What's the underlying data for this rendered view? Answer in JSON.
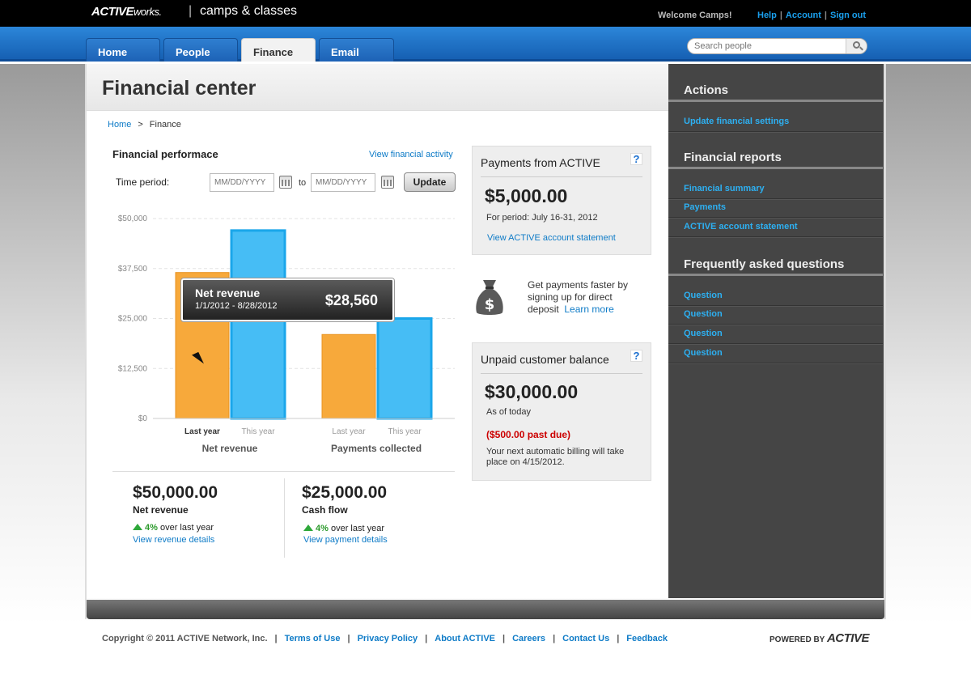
{
  "header": {
    "logo_brand": "ACTIVE",
    "logo_suffix": "works.",
    "separator": "|",
    "product": "camps & classes",
    "welcome": "Welcome Camps!",
    "links": [
      "Help",
      "Account",
      "Sign out"
    ]
  },
  "nav": {
    "tabs": [
      "Home",
      "People",
      "Finance",
      "Email"
    ],
    "active_tab": "Finance",
    "search_placeholder": "Search people"
  },
  "page": {
    "title": "Financial center",
    "breadcrumb": [
      "Home",
      "Finance"
    ],
    "breadcrumb_sep": ">"
  },
  "performance": {
    "title": "Financial performace",
    "activity_link": "View financial activity",
    "time_period_label": "Time period:",
    "date_placeholder": "MM/DD/YYYY",
    "to_label": "to",
    "update_label": "Update"
  },
  "chart_data": {
    "type": "bar",
    "categories": [
      "Net revenue",
      "Payments collected"
    ],
    "series": [
      {
        "name": "Last year",
        "values": [
          36500,
          21000
        ],
        "color": "#f7a93b"
      },
      {
        "name": "This year",
        "values": [
          47000,
          25000
        ],
        "color": "#46bdf5"
      }
    ],
    "yticks": [
      "$50,000",
      "$37,500",
      "$25,000",
      "$12,500",
      "$0"
    ],
    "ylim": [
      0,
      50000
    ],
    "grid": true
  },
  "tooltip": {
    "title": "Net revenue",
    "range": "1/1/2012 - 8/28/2012",
    "value": "$28,560"
  },
  "summary": [
    {
      "amount": "$50,000.00",
      "label": "Net revenue",
      "pct": "4%",
      "change_text": "over last year",
      "link": "View revenue details"
    },
    {
      "amount": "$25,000.00",
      "label": "Cash flow",
      "pct": "4%",
      "change_text": "over last year",
      "link": "View payment details"
    }
  ],
  "payments_panel": {
    "title": "Payments from ACTIVE",
    "amount": "$5,000.00",
    "period": "For period: July 16-31, 2012",
    "link": "View ACTIVE account statement",
    "help": "?"
  },
  "direct_deposit": {
    "text": "Get payments faster by signing up for direct deposit",
    "link": "Learn more"
  },
  "unpaid_panel": {
    "title": "Unpaid customer balance",
    "amount": "$30,000.00",
    "as_of": "As of today",
    "past_due": "($500.00 past due)",
    "billing": "Your next automatic billing will take place on 4/15/2012.",
    "help": "?",
    "past_due_color": "#cc0000"
  },
  "sidebar": {
    "sections": [
      {
        "title": "Actions",
        "items": [
          "Update financial settings"
        ]
      },
      {
        "title": "Financial reports",
        "items": [
          "Financial summary",
          "Payments",
          "ACTIVE account statement"
        ]
      },
      {
        "title": "Frequently asked questions",
        "items": [
          "Question",
          "Question",
          "Question",
          "Question"
        ]
      }
    ]
  },
  "footer": {
    "copyright": "Copyright © 2011 ACTIVE Network, Inc.",
    "links": [
      "Terms of Use",
      "Privacy Policy",
      "About ACTIVE",
      "Careers",
      "Contact Us",
      "Feedback"
    ],
    "powered_prefix": "POWERED BY",
    "powered_brand": "ACTIVE"
  },
  "colors": {
    "nav_blue": "#1d6fc6",
    "link_blue": "#0e7bc7",
    "sidebar_bg": "#454545",
    "sidebar_link": "#2db0f2"
  }
}
